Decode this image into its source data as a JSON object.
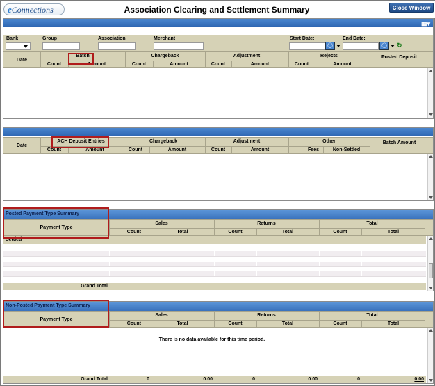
{
  "header": {
    "logo_prefix": "e",
    "logo_text": "Connections",
    "title": "Association Clearing and Settlement Summary",
    "close_label": "Close Window"
  },
  "filters": {
    "bank": "Bank",
    "group": "Group",
    "association": "Association",
    "merchant": "Merchant",
    "start_date": "Start Date:",
    "end_date": "End Date:"
  },
  "settlement_table": {
    "date": "Date",
    "batch": "Batch",
    "chargeback": "Chargeback",
    "adjustment": "Adjustment",
    "rejects": "Rejects",
    "posted_deposit": "Posted Deposit",
    "count": "Count",
    "amount": "Amount"
  },
  "ach_table": {
    "date": "Date",
    "ach_deposit_entries": "ACH Deposit Entries",
    "chargeback": "Chargeback",
    "adjustment": "Adjustment",
    "other": "Other",
    "batch_amount": "Batch Amount",
    "count": "Count",
    "amount": "Amount",
    "fees": "Fees",
    "non_settled": "Non-Settled"
  },
  "posted_summary": {
    "title": "Posted Payment Type Summary",
    "payment_type": "Payment Type",
    "sales": "Sales",
    "returns": "Returns",
    "total": "Total",
    "count": "Count",
    "total_col": "Total",
    "settled": "Settled",
    "grand_total": "Grand Total"
  },
  "nonposted_summary": {
    "title": "Non-Posted Payment Type Summary",
    "payment_type": "Payment Type",
    "sales": "Sales",
    "returns": "Returns",
    "total": "Total",
    "count": "Count",
    "total_col": "Total",
    "no_data": "There is no data available for this time period.",
    "grand_total": "Grand Total",
    "totals": [
      "0",
      "0.00",
      "0",
      "0.00",
      "0",
      "0.00"
    ]
  },
  "colors": {
    "bar": "#2e66b2",
    "header_bg": "#d6d2b6",
    "highlight": "#b01c1c"
  }
}
